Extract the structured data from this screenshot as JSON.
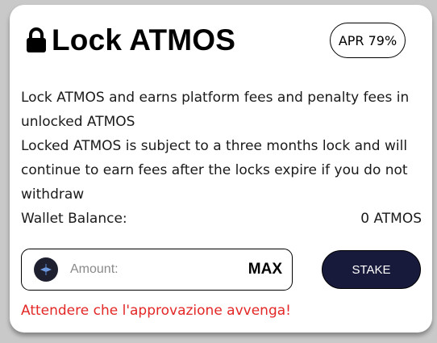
{
  "header": {
    "title": "Lock ATMOS",
    "lock_icon": "lock-icon",
    "apr_label": "APR 79%"
  },
  "description": {
    "line1": "Lock ATMOS and earns platform fees and penalty fees in unlocked ATMOS",
    "line2": "Locked ATMOS is subject to a three months lock and will continue to earn fees after the locks expire if you do not withdraw"
  },
  "balance": {
    "label": "Wallet Balance:",
    "value": "0 ATMOS"
  },
  "amount": {
    "token_icon": "atmos-token-icon",
    "placeholder": "Amount:",
    "value": "",
    "max_label": "MAX"
  },
  "actions": {
    "stake_label": "STAKE"
  },
  "status": {
    "error_message": "Attendere che l'approvazione avvenga!"
  },
  "colors": {
    "background": "#c9c9c9",
    "card": "#ffffff",
    "stake_button": "#171a3b",
    "error": "#e32626"
  }
}
